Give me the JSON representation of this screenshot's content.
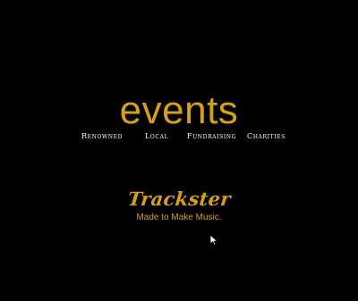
{
  "page": {
    "heading": "events"
  },
  "nav": {
    "items": [
      {
        "label": "Renowned"
      },
      {
        "label": "Local"
      },
      {
        "label": "Fundraising"
      },
      {
        "label": "Charities"
      }
    ]
  },
  "brand": {
    "name": "Trackster",
    "tagline": "Made to Make Music."
  },
  "colors": {
    "background": "#000000",
    "accent": "#d4a017",
    "nav_text": "#ffffff"
  },
  "icons": {
    "cursor": "mouse-pointer-icon"
  }
}
